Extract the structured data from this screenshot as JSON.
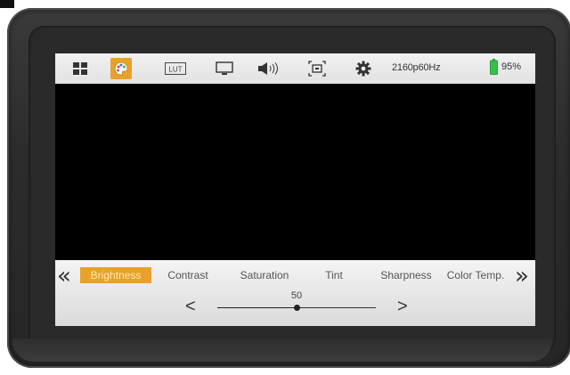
{
  "topbar": {
    "items": [
      {
        "name": "grid-menu-icon",
        "icon": "grid-icon",
        "active": false
      },
      {
        "name": "color-palette-icon",
        "icon": "palette-icon",
        "active": true
      },
      {
        "name": "lut-icon",
        "icon": "lut-icon",
        "label": "LUT",
        "active": false
      },
      {
        "name": "display-icon",
        "icon": "monitor-icon",
        "active": false
      },
      {
        "name": "audio-icon",
        "icon": "speaker-icon",
        "active": false
      },
      {
        "name": "marker-icon",
        "icon": "frame-marker-icon",
        "active": false
      },
      {
        "name": "settings-icon",
        "icon": "gear-icon",
        "active": false
      }
    ],
    "resolution": "2160p60Hz",
    "battery": {
      "percent_label": "95%",
      "level": 0.95,
      "color": "#34c24a"
    }
  },
  "panel": {
    "left_nav": "«",
    "right_nav": "»",
    "params": [
      "Brightness",
      "Contrast",
      "Saturation",
      "Tint",
      "Sharpness",
      "Color Temp."
    ],
    "active_index": 0,
    "slider": {
      "left_arrow": "<",
      "right_arrow": ">",
      "value_label": "50",
      "value": 50,
      "min": 0,
      "max": 100
    }
  },
  "colors": {
    "accent": "#e8a12c",
    "screen": "#000000",
    "bezel": "#2c2c2c"
  }
}
